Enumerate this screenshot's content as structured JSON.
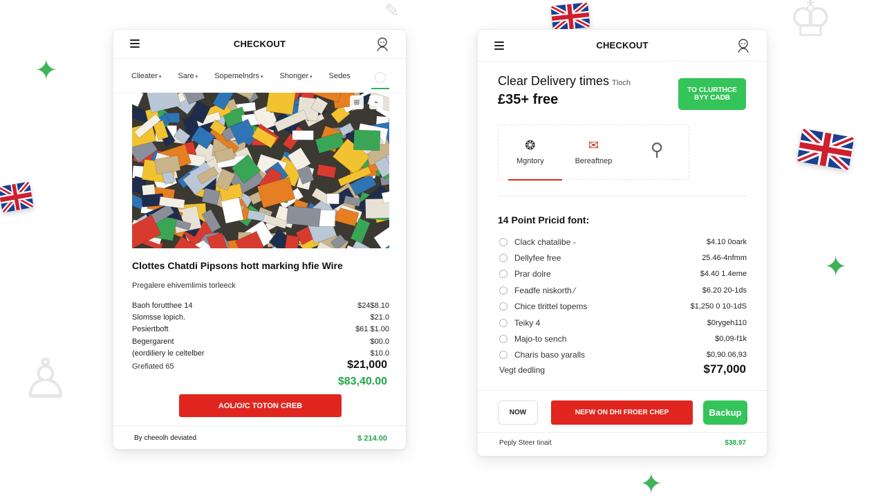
{
  "colors": {
    "accent_red": "#e0261e",
    "accent_green": "#34c45a",
    "text_green": "#25a749"
  },
  "left_panel": {
    "title": "CHECKOUT",
    "filters": [
      {
        "label": "Clieater"
      },
      {
        "label": "Sare"
      },
      {
        "label": "Sopemelndrs"
      },
      {
        "label": "Shonger"
      },
      {
        "label": "Sedes"
      }
    ],
    "image_actions": [
      "⊞",
      "⌁"
    ],
    "product_title": "Clottes Chatdi Pipsons hott marking hfie Wire",
    "product_subtitle": "Pregalere ehivemlimis torleeck",
    "lines": [
      {
        "label": "Baoh forutthee 14",
        "value": "$24$8.10"
      },
      {
        "label": "Slomsse lopich.",
        "value": "$21.0"
      },
      {
        "label": "Pesiertboft",
        "value": "$61 $1.00"
      },
      {
        "label": "Begergarent",
        "value": "$00.0"
      },
      {
        "label": "(eordiliery le celtelber",
        "value": "$10.0"
      }
    ],
    "total_label": "Grefiated 65",
    "total_value": "$21,000",
    "green_total": "$83,40.00",
    "button_label": "AOL/O/C TOTON CREB",
    "footer_label": "By cheeolh deviated",
    "footer_value": "$ 214.00"
  },
  "right_panel": {
    "title": "CHECKOUT",
    "headline": "Clear Delivery times",
    "headline_small": "Tloch",
    "headline_price": "£35+ free",
    "cta_label": "TO CLURTHCE BYY CADB",
    "options": [
      {
        "label": "Mgntory",
        "icon": "❂"
      },
      {
        "label": "Bereaftnep",
        "icon": "✉"
      },
      {
        "label": "",
        "icon": "⚲"
      }
    ],
    "section_title": "14 Point Pricid font:",
    "items": [
      {
        "label": "Clack chatalibe -",
        "value": "$4.10 0oark"
      },
      {
        "label": "Dellyfee free",
        "value": "25.46-4nfmm"
      },
      {
        "label": "Prar dolre",
        "value": "$4.40 1.4eme"
      },
      {
        "label": "Feadfe niskorth ⁄",
        "value": "$6.20 20-1ds"
      },
      {
        "label": "Chice tlrittel topems",
        "value": "$1,250 0 10-1dS"
      },
      {
        "label": "Teiky 4",
        "value": "$0rygeh110"
      },
      {
        "label": "Majo-to sench",
        "value": "$0,09-f1k"
      },
      {
        "label": "Charis baso yaralls",
        "value": "$0,90.06,93"
      }
    ],
    "total_label": "Vegt dedling",
    "total_value": "$77,000",
    "btn_now": "NOW",
    "btn_main": "NEFW ON DHI FROER CHEP",
    "btn_green": "Backup",
    "footer_label": "Peply Steer tinait",
    "footer_value": "$38.97"
  }
}
